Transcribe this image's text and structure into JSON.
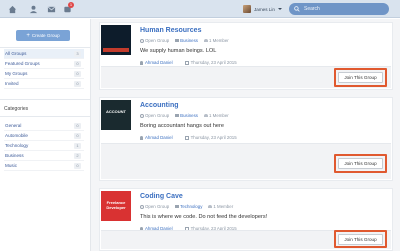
{
  "topbar": {
    "badge_count": "1",
    "user_name": "James Lin",
    "search_placeholder": "Search",
    "icons": [
      "home-icon",
      "user-icon",
      "mail-icon",
      "notifications-icon"
    ]
  },
  "sidebar": {
    "create_label": "Create Group",
    "filters": [
      {
        "label": "All Groups",
        "count": "3",
        "active": true
      },
      {
        "label": "Featured Groups",
        "count": "0"
      },
      {
        "label": "My Groups",
        "count": "0"
      },
      {
        "label": "Invited",
        "count": "0"
      }
    ],
    "categories_heading": "Categories",
    "categories": [
      {
        "label": "General",
        "count": "0"
      },
      {
        "label": "Automobile",
        "count": "0"
      },
      {
        "label": "Technology",
        "count": "1"
      },
      {
        "label": "Business",
        "count": "2"
      },
      {
        "label": "Music",
        "count": "0"
      }
    ]
  },
  "groups": [
    {
      "title": "Human Resources",
      "privacy": "Open Group",
      "category": "Business",
      "members": "1 Member",
      "description": "We supply human beings. LOL",
      "author": "Ahmad Daniel",
      "date": "Thursday, 23 April 2015",
      "join_label": "Join This Group"
    },
    {
      "title": "Accounting",
      "privacy": "Open Group",
      "category": "Business",
      "members": "1 Member",
      "description": "Boring accountant hangs out here",
      "author": "Ahmad Daniel",
      "date": "Thursday, 23 April 2015",
      "join_label": "Join This Group",
      "thumb_text": "ACCOUNT"
    },
    {
      "title": "Coding Cave",
      "privacy": "Open Group",
      "category": "Technology",
      "members": "1 Member",
      "description": "This is where we code. Do not feed the developers!",
      "author": "Ahmad Daniel",
      "date": "Thursday, 23 April 2015",
      "join_label": "Join This Group",
      "thumb_text": "Freelance Developer"
    }
  ],
  "colors": {
    "accent": "#3b6fc0",
    "highlight": "#e0592f",
    "create_button": "#7aa3d6"
  }
}
